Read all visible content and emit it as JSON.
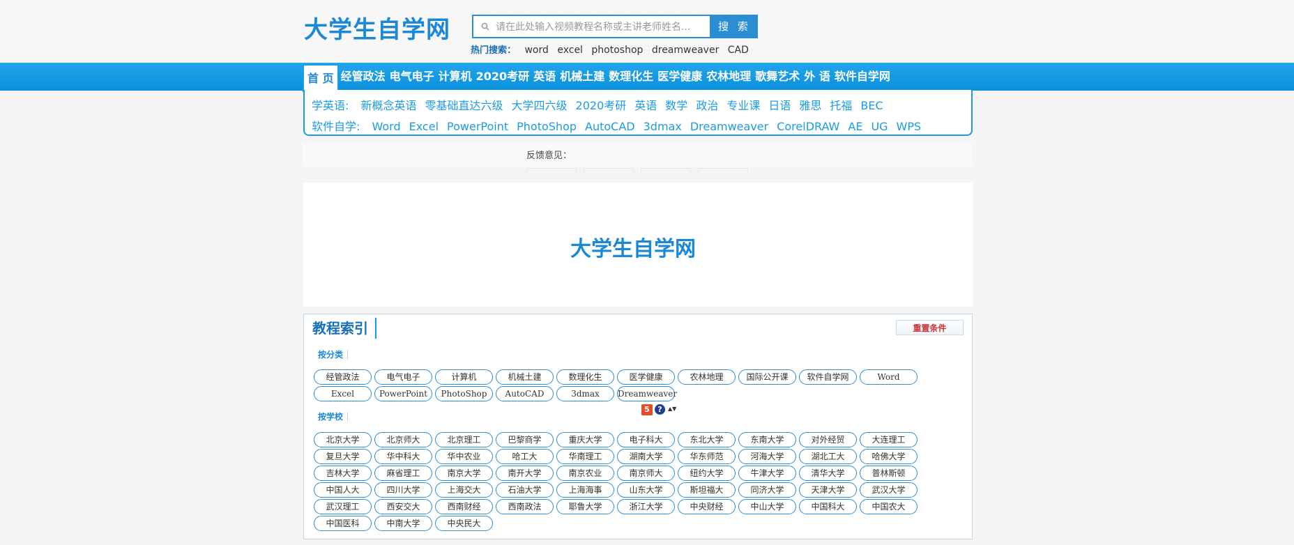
{
  "header": {
    "logo_text": "大学生自学网",
    "search": {
      "placeholder": "请在此处输入视频教程名称或主讲老师姓名...",
      "button_label": "搜 索"
    },
    "hot_search": {
      "label": "热门搜索：",
      "items": [
        "word",
        "excel",
        "photoshop",
        "dreamweaver",
        "CAD"
      ]
    }
  },
  "nav": {
    "items": [
      "首 页",
      "经管政法",
      "电气电子",
      "计算机",
      "2020考研",
      "英语",
      "机械土建",
      "数理化生",
      "医学健康",
      "农林地理",
      "歌舞艺术",
      "外 语",
      "软件自学网"
    ],
    "active_index": 0
  },
  "sub_nav": {
    "row1": {
      "label": "学英语:",
      "items": [
        "新概念英语",
        "零基础直达六级",
        "大学四六级",
        "2020考研",
        "英语",
        "数学",
        "政治",
        "专业课",
        "日语",
        "雅思",
        "托福",
        "BEC"
      ]
    },
    "row2": {
      "label": "软件自学:",
      "items": [
        "Word",
        "Excel",
        "PowerPoint",
        "PhotoShop",
        "AutoCAD",
        "3dmax",
        "Dreamweaver",
        "CorelDRAW",
        "AE",
        "UG",
        "WPS"
      ]
    }
  },
  "feedback": {
    "label": "反馈意见："
  },
  "banner": {
    "logo_text": "大学生自学网"
  },
  "index_panel": {
    "title": "教程索引",
    "reset_label": "重置条件",
    "by_category": {
      "label": "按分类",
      "tags": [
        "经管政法",
        "电气电子",
        "计算机",
        "机械土建",
        "数理化生",
        "医学健康",
        "农林地理",
        "国际公开课",
        "软件自学网",
        "Word",
        "Excel",
        "PowerPoint",
        "PhotoShop",
        "AutoCAD",
        "3dmax",
        "Dreamweaver"
      ]
    },
    "by_school": {
      "label": "按学校",
      "tags": [
        "北京大学",
        "北京师大",
        "北京理工",
        "巴黎商学",
        "重庆大学",
        "电子科大",
        "东北大学",
        "东南大学",
        "对外经贸",
        "大连理工",
        "复旦大学",
        "华中科大",
        "华中农业",
        "哈工大",
        "华南理工",
        "湖南大学",
        "华东师范",
        "河海大学",
        "湖北工大",
        "哈佛大学",
        "吉林大学",
        "麻省理工",
        "南京大学",
        "南开大学",
        "南京农业",
        "南京师大",
        "纽约大学",
        "牛津大学",
        "清华大学",
        "普林斯顿",
        "中国人大",
        "四川大学",
        "上海交大",
        "石油大学",
        "上海海事",
        "山东大学",
        "斯坦福大",
        "同济大学",
        "天津大学",
        "武汉大学",
        "武汉理工",
        "西安交大",
        "西南财经",
        "西南政法",
        "耶鲁大学",
        "浙江大学",
        "中央财经",
        "中山大学",
        "中国科大",
        "中国农大",
        "中国医科",
        "中南大学",
        "中央民大"
      ]
    },
    "float_icons": {
      "html5": "5",
      "help": "?",
      "arrows": "▲▼"
    }
  }
}
